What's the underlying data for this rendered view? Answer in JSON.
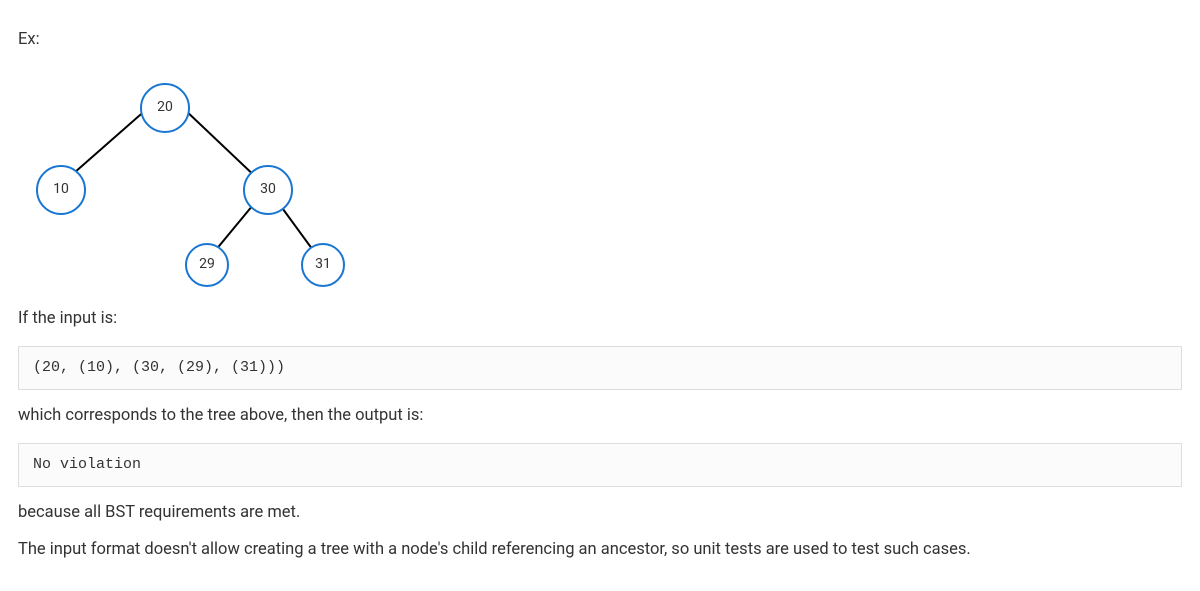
{
  "text": {
    "ex_label": "Ex:",
    "if_input": "If the input is:",
    "corresponds": "which corresponds to the tree above, then the output is:",
    "because": "because all BST requirements are met.",
    "format_note": "The input format doesn't allow creating a tree with a node's child referencing an ancestor, so unit tests are used to test such cases."
  },
  "code": {
    "input": "(20, (10), (30, (29), (31)))",
    "output": "No violation"
  },
  "tree": {
    "nodes": {
      "root": {
        "value": "20"
      },
      "left": {
        "value": "10"
      },
      "right": {
        "value": "30"
      },
      "rl": {
        "value": "29"
      },
      "rr": {
        "value": "31"
      }
    }
  }
}
